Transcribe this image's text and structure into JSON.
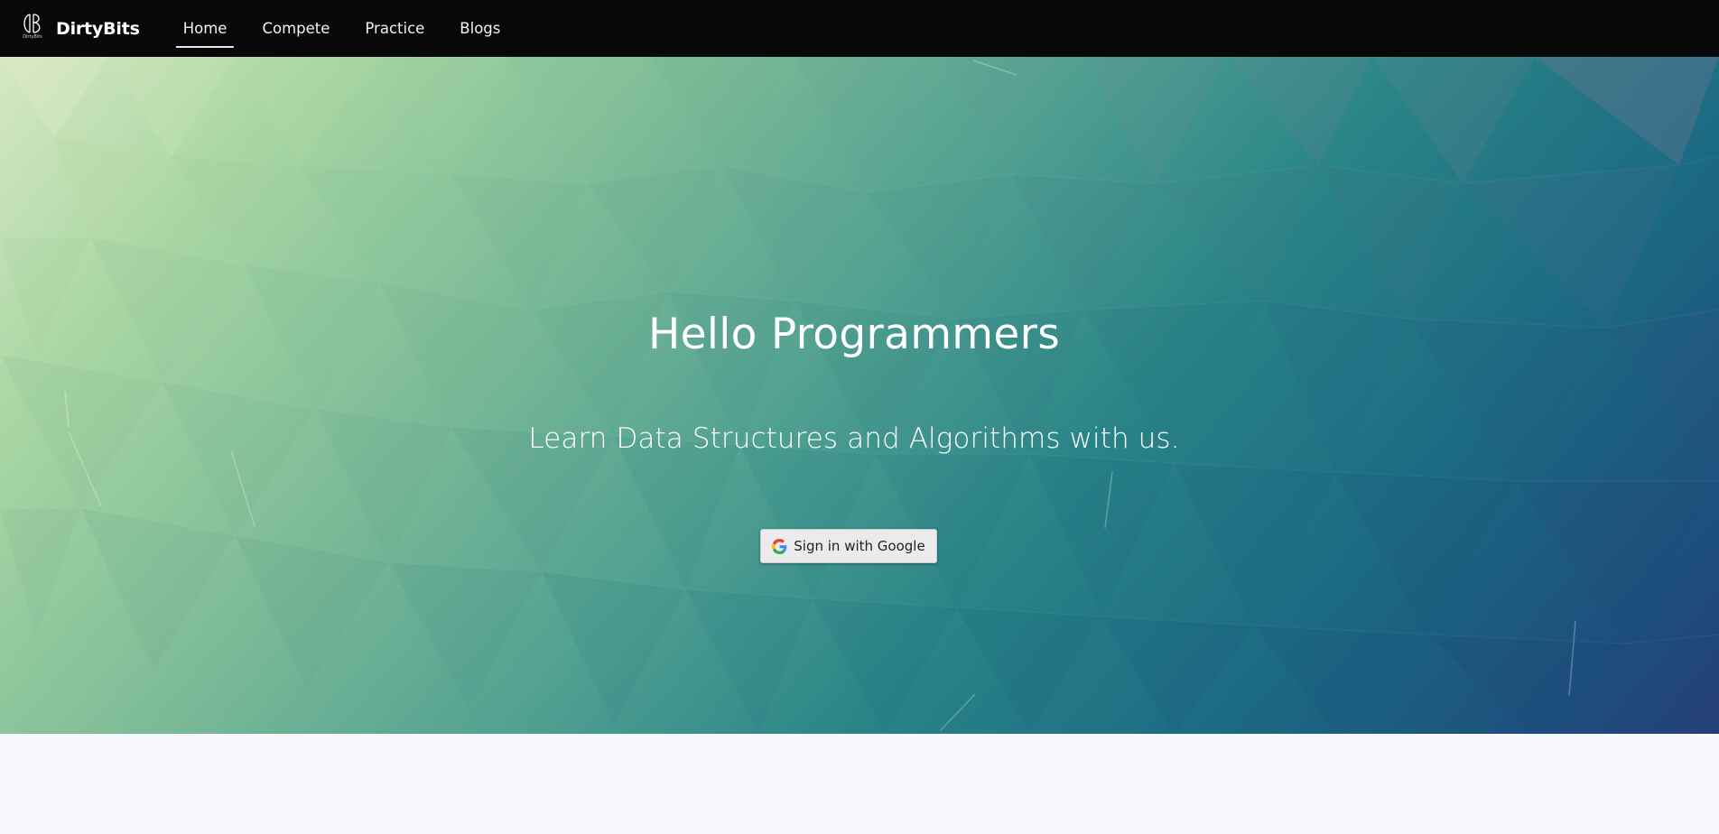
{
  "brand": {
    "name": "DirtyBits",
    "logo_caption": "DirtyBits"
  },
  "nav": {
    "items": [
      {
        "label": "Home",
        "active": true
      },
      {
        "label": "Compete",
        "active": false
      },
      {
        "label": "Practice",
        "active": false
      },
      {
        "label": "Blogs",
        "active": false
      }
    ]
  },
  "hero": {
    "title": "Hello Programmers",
    "subtitle": "Learn Data Structures and Algorithms with us.",
    "signin_label": "Sign in with Google"
  },
  "colors": {
    "navbar": "#080808",
    "hero_start": "#d6e8c2",
    "hero_mid": "#2a8487",
    "hero_end": "#253f74",
    "page_background": "#f7f8fc"
  },
  "icons": {
    "logo": "db-logo-icon",
    "signin": "google-g-icon"
  }
}
